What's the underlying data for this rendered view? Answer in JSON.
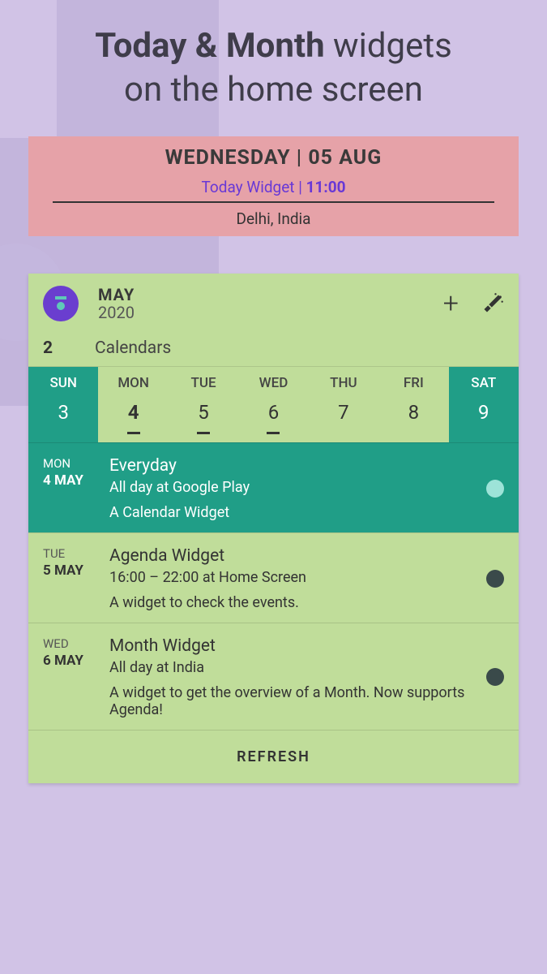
{
  "headline": {
    "part1": "Today & Month",
    "part2": " widgets",
    "part3": "on the home screen"
  },
  "today_widget": {
    "date": "WEDNESDAY | 05 AUG",
    "label": "Today Widget | ",
    "time": "11:00",
    "location": "Delhi, India"
  },
  "month_widget": {
    "month": "MAY",
    "year": "2020",
    "calendar_count": "2",
    "calendar_label": "Calendars",
    "icons": {
      "add": "plus-icon",
      "wand": "wand-icon"
    },
    "week": {
      "days": [
        {
          "name": "SUN",
          "num": "3",
          "weekend": true,
          "today": false,
          "mark": false
        },
        {
          "name": "MON",
          "num": "4",
          "weekend": false,
          "today": true,
          "mark": true
        },
        {
          "name": "TUE",
          "num": "5",
          "weekend": false,
          "today": false,
          "mark": true
        },
        {
          "name": "WED",
          "num": "6",
          "weekend": false,
          "today": false,
          "mark": true
        },
        {
          "name": "THU",
          "num": "7",
          "weekend": false,
          "today": false,
          "mark": false
        },
        {
          "name": "FRI",
          "num": "8",
          "weekend": false,
          "today": false,
          "mark": false
        },
        {
          "name": "SAT",
          "num": "9",
          "weekend": true,
          "today": false,
          "mark": false
        }
      ]
    },
    "events": [
      {
        "dow": "MON",
        "date": "4 MAY",
        "title": "Everyday",
        "sub": "All day at Google Play",
        "desc": "A Calendar Widget",
        "highlight": true,
        "dot": "#9de3d8"
      },
      {
        "dow": "TUE",
        "date": "5 MAY",
        "title": "Agenda Widget",
        "sub": "16:00 – 22:00 at Home Screen",
        "desc": "A widget to check the events.",
        "highlight": false,
        "dot": "#3a4a4a"
      },
      {
        "dow": "WED",
        "date": "6 MAY",
        "title": "Month Widget",
        "sub": "All day at India",
        "desc": "A widget to get the overview of a Month. Now supports Agenda!",
        "highlight": false,
        "dot": "#3a4a4a"
      }
    ],
    "refresh": "REFRESH"
  }
}
